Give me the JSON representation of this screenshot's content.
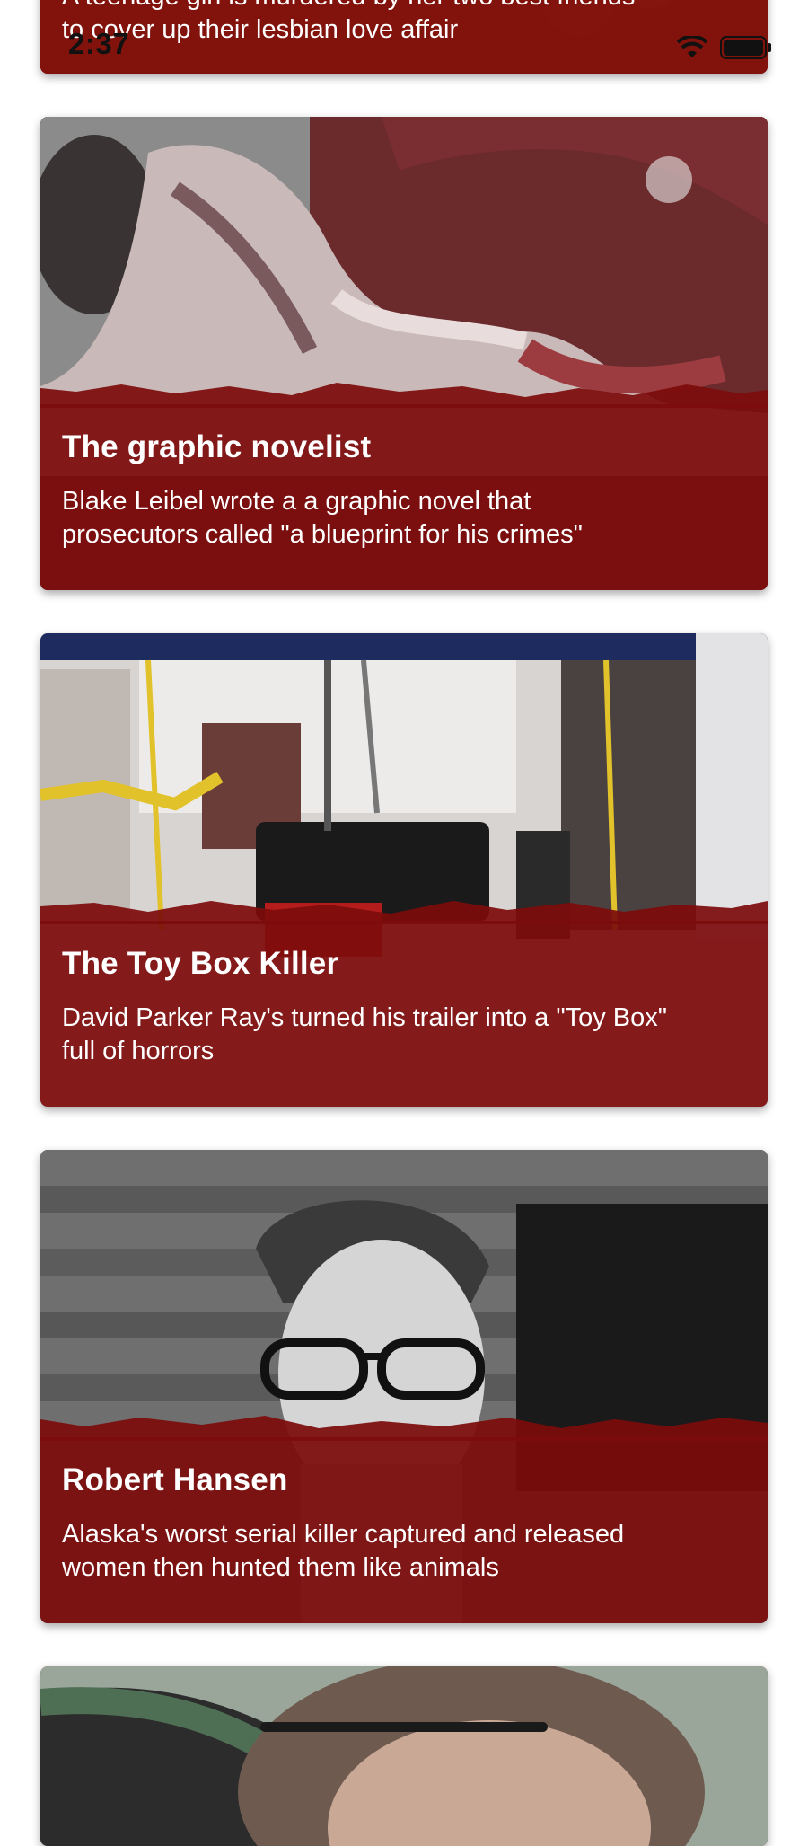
{
  "status_bar": {
    "time": "2:37"
  },
  "cards": [
    {
      "title": "",
      "desc_lines": [
        "A teenage girl is murdered by her two best friends",
        "to cover up their lesbian love affair"
      ]
    },
    {
      "title": "The graphic novelist",
      "desc_lines": [
        "Blake Leibel wrote a a graphic novel that",
        "prosecutors called \"a blueprint for his crimes\""
      ]
    },
    {
      "title": "The Toy Box Killer",
      "desc_lines": [
        "David Parker Ray's turned his trailer into a \"Toy Box\"",
        "full of horrors"
      ]
    },
    {
      "title": "Robert Hansen",
      "desc_lines": [
        "Alaska's worst serial killer captured and released",
        "women then hunted them like animals"
      ]
    }
  ]
}
